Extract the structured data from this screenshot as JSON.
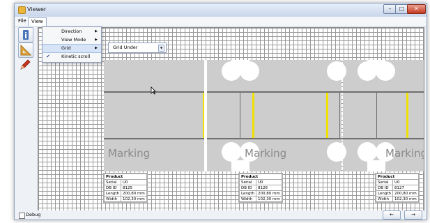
{
  "window": {
    "title": "Viewer"
  },
  "menubar": {
    "file": "File",
    "view": "View"
  },
  "view_menu": {
    "items": [
      {
        "label": "Direction",
        "submenu": true,
        "checked": false
      },
      {
        "label": "View Mode",
        "submenu": true,
        "checked": false
      },
      {
        "label": "Grid",
        "submenu": true,
        "checked": false
      },
      {
        "label": "Kinetic scroll",
        "submenu": false,
        "checked": true
      }
    ]
  },
  "grid_submenu": {
    "selected": "Grid Under"
  },
  "toolbar": {
    "icons": [
      "info-icon",
      "ruler-icon",
      "pencil-icon"
    ]
  },
  "canvas": {
    "marking_label": "Marking",
    "products": [
      {
        "title": "Product",
        "serial_label": "Serial",
        "serial": "U0",
        "dbid_label": "DB ID",
        "dbid": "8125",
        "length_label": "Length",
        "length": "200,80 mm",
        "width_label": "Width",
        "width": "102,30 mm"
      },
      {
        "title": "Product",
        "serial_label": "Serial",
        "serial": "U0",
        "dbid_label": "DB ID",
        "dbid": "8126",
        "length_label": "Length",
        "length": "200,80 mm",
        "width_label": "Width",
        "width": "102,30 mm"
      },
      {
        "title": "Product",
        "serial_label": "Serial",
        "serial": "U0",
        "dbid_label": "DB ID",
        "dbid": "8127",
        "length_label": "Length",
        "length": "200,80 mm",
        "width_label": "Width",
        "width": "102,30 mm"
      }
    ]
  },
  "statusbar": {
    "debug_label": "Debug",
    "prev": "←",
    "next": "→"
  },
  "colors": {
    "panel": "#cdcdcd",
    "seam_highlight": "#f0e100",
    "grid": "#9a9a9a"
  }
}
